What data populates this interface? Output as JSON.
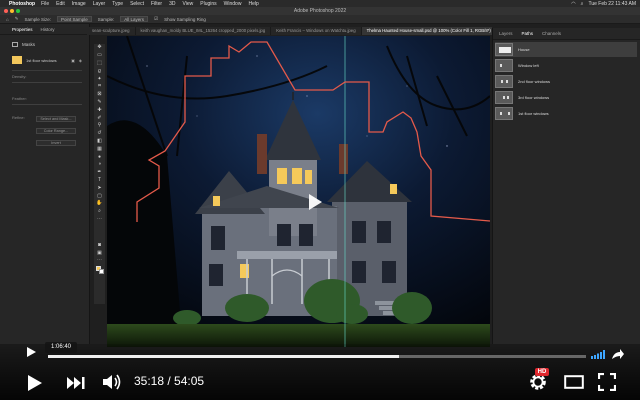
{
  "menubar": {
    "app": "Photoshop",
    "items": [
      "File",
      "Edit",
      "Image",
      "Layer",
      "Type",
      "Select",
      "Filter",
      "3D",
      "View",
      "Plugins",
      "Window",
      "Help"
    ],
    "clock": "Tue Feb 22 11:43 AM"
  },
  "window": {
    "title": "Adobe Photoshop 2022"
  },
  "options_bar": {
    "sample_size_label": "Sample Size:",
    "sample_size_value": "Point Sample",
    "sample_label": "Sample:",
    "sample_value": "All Layers",
    "show_ring": "Show Sampling Ring"
  },
  "properties": {
    "tabs": [
      "Properties",
      "History"
    ],
    "masks_label": "Masks",
    "layer_name": "1st floor windows",
    "density_label": "Density:",
    "feather_label": "Feather:",
    "refine_label": "Refine:",
    "buttons": [
      "Select and Mask...",
      "Color Range...",
      "Invert"
    ]
  },
  "doc_tabs": [
    "sean-sculpture.jpeg",
    "keith vaughan_moldy BLUE_IML_15264 cropped_2000 pixels.jpg",
    "Keith Francis – Windows on Watchtu.jpeg",
    "Thelma Haunted House-small.psd @ 100% (Color Fill 1, RGB/8*)"
  ],
  "paths_panel": {
    "tabs": [
      "Layers",
      "Paths",
      "Channels"
    ],
    "active_tab": "Paths",
    "items": [
      {
        "label": "House",
        "selected": true
      },
      {
        "label": "Window left",
        "selected": false
      },
      {
        "label": "2nd floor windows",
        "selected": false
      },
      {
        "label": "3rd floor windows",
        "selected": false
      },
      {
        "label": "1st floor windows",
        "selected": false
      }
    ]
  },
  "player": {
    "hover_time": "1:06:40",
    "current_time": "35:18",
    "duration": "54:05",
    "time_separator": " / ",
    "progress_fraction": 0.653,
    "hd_label": "HD"
  },
  "colors": {
    "path_outline": "#e45a4a",
    "foreground_swatch": "#f2c75c",
    "hd_badge": "#e0282e"
  }
}
